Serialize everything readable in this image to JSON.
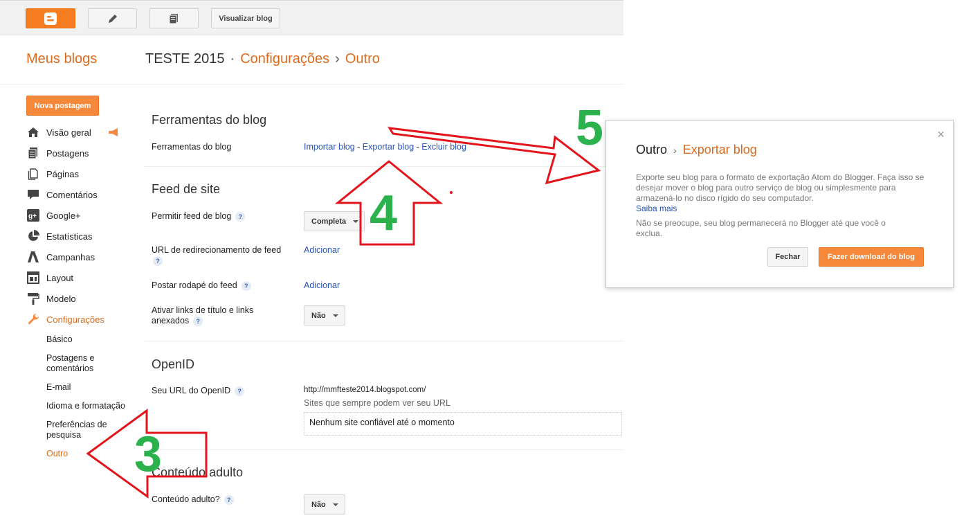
{
  "toolbar": {
    "view_blog_label": "Visualizar blog"
  },
  "header": {
    "my_blogs": "Meus blogs",
    "blog_name": "TESTE 2015",
    "dot": "·",
    "section": "Configurações",
    "chevron": "›",
    "page": "Outro"
  },
  "sidebar": {
    "new_post": "Nova postagem",
    "items": [
      {
        "label": "Visão geral",
        "icon": "home-icon"
      },
      {
        "label": "Postagens",
        "icon": "posts-icon"
      },
      {
        "label": "Páginas",
        "icon": "pages-icon"
      },
      {
        "label": "Comentários",
        "icon": "comments-icon"
      },
      {
        "label": "Google+",
        "icon": "google-plus-icon"
      },
      {
        "label": "Estatísticas",
        "icon": "stats-icon"
      },
      {
        "label": "Campanhas",
        "icon": "campaigns-icon"
      },
      {
        "label": "Layout",
        "icon": "layout-icon"
      },
      {
        "label": "Modelo",
        "icon": "template-icon"
      },
      {
        "label": "Configurações",
        "icon": "wrench-icon"
      }
    ],
    "settings_sub": [
      "Básico",
      "Postagens e comentários",
      "E-mail",
      "Idioma e formatação",
      "Preferências de pesquisa",
      "Outro"
    ]
  },
  "main": {
    "tools": {
      "title": "Ferramentas do blog",
      "row_label": "Ferramentas do blog",
      "import": "Importar blog",
      "export": "Exportar blog",
      "delete": "Excluir blog",
      "dash": "-"
    },
    "feed": {
      "title": "Feed de site",
      "allow_label": "Permitir feed de blog",
      "allow_value": "Completa",
      "redirect_label": "URL de redirecionamento de feed",
      "redirect_action": "Adicionar",
      "footer_label": "Postar rodapé do feed",
      "footer_action": "Adicionar",
      "links_label": "Ativar links de título e links anexados",
      "links_value": "Não"
    },
    "openid": {
      "title": "OpenID",
      "url_label": "Seu URL do OpenID",
      "url_value": "http://mmfteste2014.blogspot.com/",
      "sites_label": "Sites que sempre podem ver seu URL",
      "sites_value": "Nenhum site confiável até o momento"
    },
    "adult": {
      "title": "Conteúdo adulto",
      "label": "Conteúdo adulto?",
      "value": "Não"
    },
    "help_glyph": "?"
  },
  "dialog": {
    "title_prefix": "Outro",
    "chevron": "›",
    "title": "Exportar blog",
    "close_glyph": "×",
    "text": "Exporte seu blog para o formato de exportação Atom do Blogger. Faça isso se desejar mover o blog para outro serviço de blog ou simplesmente para armazená-lo no disco rígido do seu computador.",
    "learn_more": "Saiba mais",
    "text2": "Não se preocupe, seu blog permanecerá no Blogger até que você o exclua.",
    "close_button": "Fechar",
    "download_button": "Fazer download do blog"
  },
  "annotations": {
    "step3": "3",
    "step4": "4",
    "step5": "5",
    "arrow_color": "#e3141c",
    "number_color": "#2bb24c"
  }
}
